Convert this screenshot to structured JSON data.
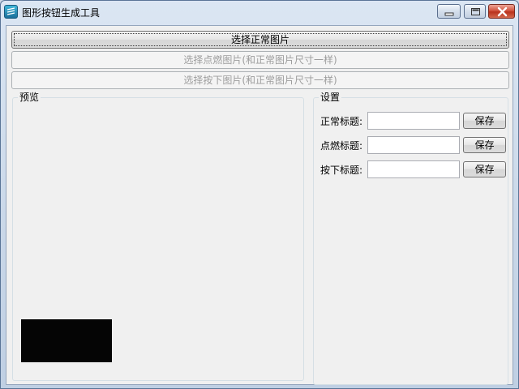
{
  "window": {
    "title": "图形按钮生成工具"
  },
  "buttons": {
    "select_normal": "选择正常图片",
    "select_hover": "选择点燃图片(和正常图片尺寸一样)",
    "select_pressed": "选择按下图片(和正常图片尺寸一样)"
  },
  "preview": {
    "label": "预览"
  },
  "settings": {
    "label": "设置",
    "rows": [
      {
        "label": "正常标题:",
        "value": "",
        "save": "保存"
      },
      {
        "label": "点燃标题:",
        "value": "",
        "save": "保存"
      },
      {
        "label": "按下标题:",
        "value": "",
        "save": "保存"
      }
    ]
  }
}
